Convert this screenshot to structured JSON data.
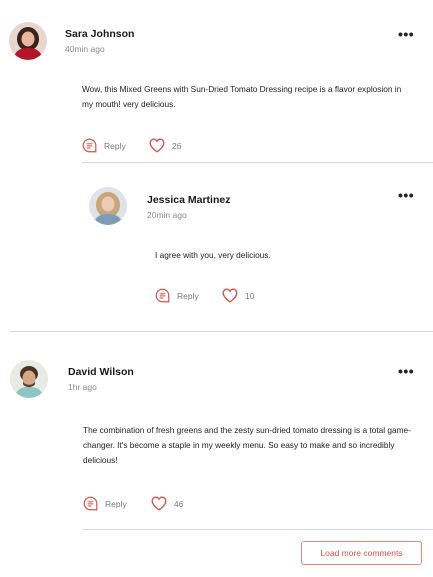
{
  "comments": [
    {
      "author": "Sara Johnson",
      "time": "40min ago",
      "text": "Wow, this Mixed Greens with Sun-Dried Tomato Dressing recipe is a flavor explosion in my mouth! very delicious.",
      "reply_label": "Reply",
      "likes": "26",
      "more": "•••"
    },
    {
      "author": "Jessica Martinez",
      "time": "20min ago",
      "text": "I agree with you, very delicious.",
      "reply_label": "Reply",
      "likes": "10",
      "more": "•••"
    },
    {
      "author": "David Wilson",
      "time": "1hr ago",
      "text": "The combination of fresh greens and the zesty sun-dried tomato dressing is a total game-changer. It's become a staple in my weekly menu. So easy to make and so incredibly delicious!",
      "reply_label": "Reply",
      "likes": "46",
      "more": "•••"
    }
  ],
  "load_more": "Load more comments",
  "colors": {
    "accent": "#d0564a",
    "divider": "#d7d7d7"
  },
  "icons": {
    "reply": "comment-bubble-icon",
    "like": "heart-outline-icon",
    "more": "more-dots-icon"
  }
}
